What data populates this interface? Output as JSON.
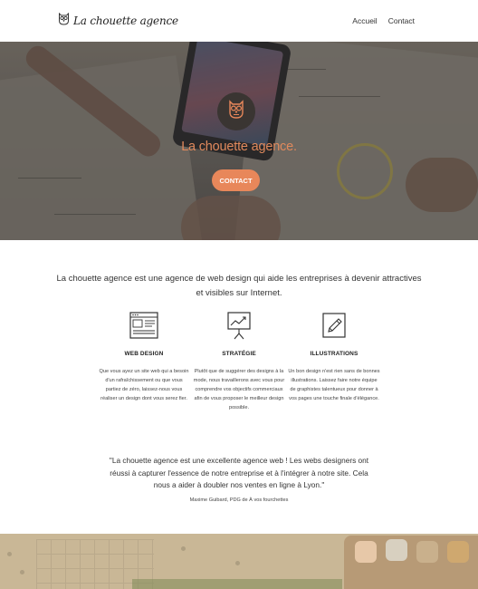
{
  "header": {
    "brand": "La chouette agence",
    "nav": [
      "Accueil",
      "Contact"
    ]
  },
  "hero": {
    "title": "La chouette agence.",
    "cta": "CONTACT",
    "accent_color": "#e8875a"
  },
  "intro": "La chouette agence est une agence de web design qui aide les entreprises à devenir attractives et visibles sur Internet.",
  "services": [
    {
      "icon": "browser-window-icon",
      "title": "WEB DESIGN",
      "description": "Que vous ayez un site web qui a besoin d'un rafraîchissement ou que vous partiez de zéro, laissez-nous vous réaliser un design dont vous serez fier."
    },
    {
      "icon": "presentation-chart-icon",
      "title": "STRATÉGIE",
      "description": "Plutôt que de suggérer des designs à la mode, nous travaillerons avec vous pour comprendre vos objectifs commerciaux afin de vous proposer le meilleur design possible."
    },
    {
      "icon": "pencil-frame-icon",
      "title": "ILLUSTRATIONS",
      "description": "Un bon design n'est rien sans de bonnes illustrations. Laissez faire notre équipe de graphistes talentueux pour donner à vos pages une touche finale d'élégance."
    }
  ],
  "testimonial": {
    "quote": "\"La chouette agence est une excellente agence web ! Les webs designers ont réussi à capturer l'essence de notre entreprise et à l'intégrer à notre site. Cela nous a aider à doubler nos ventes en ligne à Lyon.\"",
    "author": "Maxime Guibard, PDG de À vos fourchettes"
  }
}
